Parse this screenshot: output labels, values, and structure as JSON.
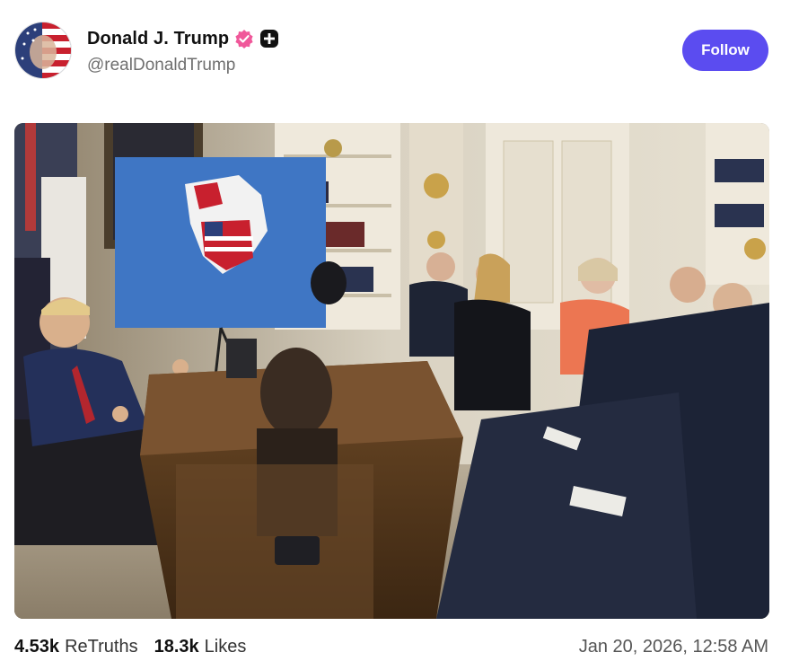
{
  "user": {
    "display_name": "Donald J. Trump",
    "handle": "@realDonaldTrump",
    "verified_icon": "verified-badge-icon",
    "plus_icon": "plus-badge-icon",
    "avatar_icon": "profile-avatar",
    "verified_color": "#f0589a"
  },
  "follow_button": {
    "label": "Follow",
    "color": "#5b4cf0"
  },
  "post": {
    "image_icon": "post-photo"
  },
  "stats": {
    "retruths_count": "4.53k",
    "retruths_label": "ReTruths",
    "likes_count": "18.3k",
    "likes_label": "Likes"
  },
  "timestamp": "Jan 20, 2026, 12:58 AM"
}
